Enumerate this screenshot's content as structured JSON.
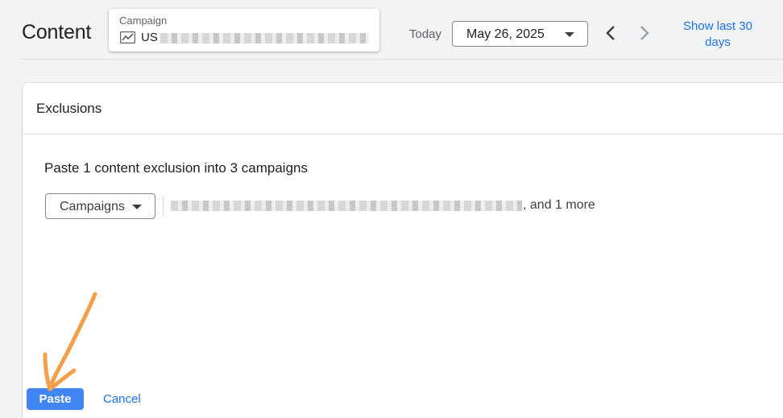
{
  "header": {
    "title": "Content",
    "campaign_label": "Campaign",
    "campaign_name_prefix": "US",
    "today_label": "Today",
    "date_value": "May 26, 2025",
    "show_last_label": "Show last 30 days"
  },
  "panel": {
    "title": "Exclusions",
    "heading": "Paste 1 content exclusion into 3 campaigns",
    "campaigns_select": "Campaigns",
    "more_suffix": ", and 1 more"
  },
  "actions": {
    "paste": "Paste",
    "cancel": "Cancel"
  },
  "colors": {
    "accent": "#1a73e8",
    "primary_button": "#4285f4",
    "annotation": "#f4a04b"
  },
  "icons": {
    "campaign": "trending-chart-icon",
    "prev": "chevron-left-icon",
    "next": "chevron-right-icon",
    "dropdown": "caret-down-icon"
  }
}
